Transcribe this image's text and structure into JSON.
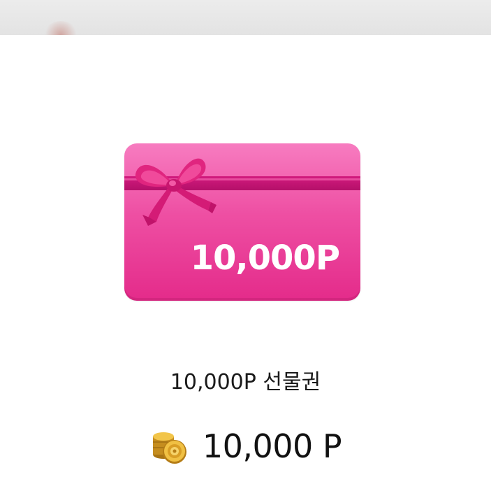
{
  "gift_card": {
    "amount_label": "10,000P",
    "card_color": "#ee4fa3",
    "ribbon_color": "#c2146f",
    "bow_icon": "ribbon-bow-icon"
  },
  "product": {
    "name": "10,000P 선물권"
  },
  "price": {
    "icon": "coin-stack-icon",
    "value": "10,000 P"
  }
}
